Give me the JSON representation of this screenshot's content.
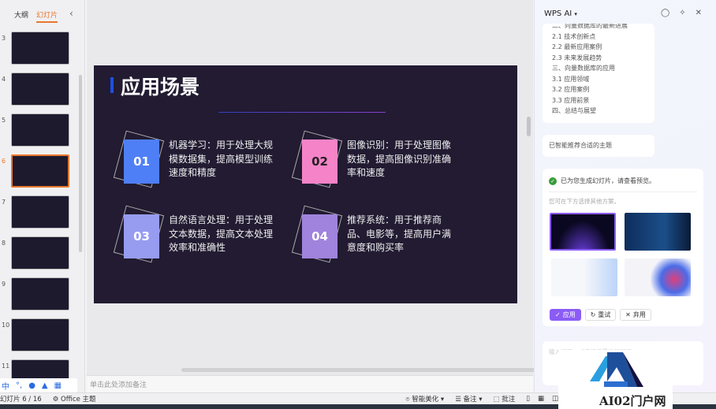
{
  "left_panel": {
    "tabs": [
      "大纲",
      "幻灯片"
    ],
    "active_tab": "幻灯片",
    "collapse_icon": "chevron-left-icon",
    "thumbnails": [
      {
        "num": "3"
      },
      {
        "num": "4"
      },
      {
        "num": "5"
      },
      {
        "num": "6",
        "selected": true
      },
      {
        "num": "7"
      },
      {
        "num": "8"
      },
      {
        "num": "9"
      },
      {
        "num": "10"
      },
      {
        "num": "11"
      }
    ],
    "ime_bar": [
      "中",
      "°,"
    ]
  },
  "slide": {
    "title": "应用场景",
    "accent": "#1f4fe0",
    "items": [
      {
        "num": "01",
        "text": "机器学习：用于处理大规模数据集，提高模型训练速度和精度",
        "color": "#4f7ff7"
      },
      {
        "num": "02",
        "text": "图像识别：用于处理图像数据，提高图像识别准确率和速度",
        "color": "#f583c8"
      },
      {
        "num": "03",
        "text": "自然语言处理：用于处理文本数据，提高文本处理效率和准确性",
        "color": "#979cf1"
      },
      {
        "num": "04",
        "text": "推荐系统：用于推荐商品、电影等，提高用户满意度和购买率",
        "color": "#a083dc"
      }
    ]
  },
  "notes_placeholder": "单击此处添加备注",
  "status": {
    "slide_count": "幻灯片 6 / 16",
    "theme": "Office 主题",
    "beautify": "智能美化",
    "notes": "备注",
    "comments": "批注"
  },
  "ai_panel": {
    "title": "WPS AI",
    "toc": [
      "二、向量数据库的最新进展",
      "2.1 技术创新点",
      "2.2 最新应用案例",
      "2.3 未来发展趋势",
      "三、向量数据库的应用",
      "3.1 应用领域",
      "3.2 应用案例",
      "3.3 应用前景",
      "四、总结与展望"
    ],
    "theme_msg": "已智能推荐合适的主题",
    "done_msg": "已为您生成幻灯片，请查看预览。",
    "choose_msg": "您可在下方选择其他方案。",
    "buttons": {
      "apply": "应用",
      "retry": "重试",
      "discard": "弃用"
    },
    "input_placeholder": "输入问题，或选择场景进行提问",
    "accent": "#8b5cf6"
  },
  "watermark": "AI02门户网"
}
